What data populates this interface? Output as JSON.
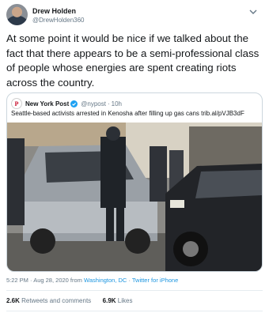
{
  "author": {
    "name": "Drew Holden",
    "handle": "@DrewHolden360"
  },
  "tweet_text": "At some point it would be nice if we talked about the fact that there appears to be a semi-professional class of people whose energies are spent creating riots across the country.",
  "quoted": {
    "account_name": "New York Post",
    "handle": "@nypost",
    "separator": "·",
    "time": "10h",
    "text": "Seattle-based activists arrested in Kenosha after filling up gas cans trib.al/pVJB3dF"
  },
  "meta": {
    "time": "5:22 PM",
    "sep1": "·",
    "date": "Aug 28, 2020",
    "from_word": "from",
    "location": "Washington, DC",
    "sep2": "·",
    "client": "Twitter for iPhone"
  },
  "stats": {
    "retweets_count": "2.6K",
    "retweets_label": "Retweets and comments",
    "likes_count": "6.9K",
    "likes_label": "Likes"
  },
  "colors": {
    "link": "#1b95e0",
    "secondary": "#657786",
    "verified": "#1da1f2",
    "nyp_red": "#c8102e"
  },
  "icons": [
    "chevron-down-icon",
    "verified-badge-icon"
  ]
}
